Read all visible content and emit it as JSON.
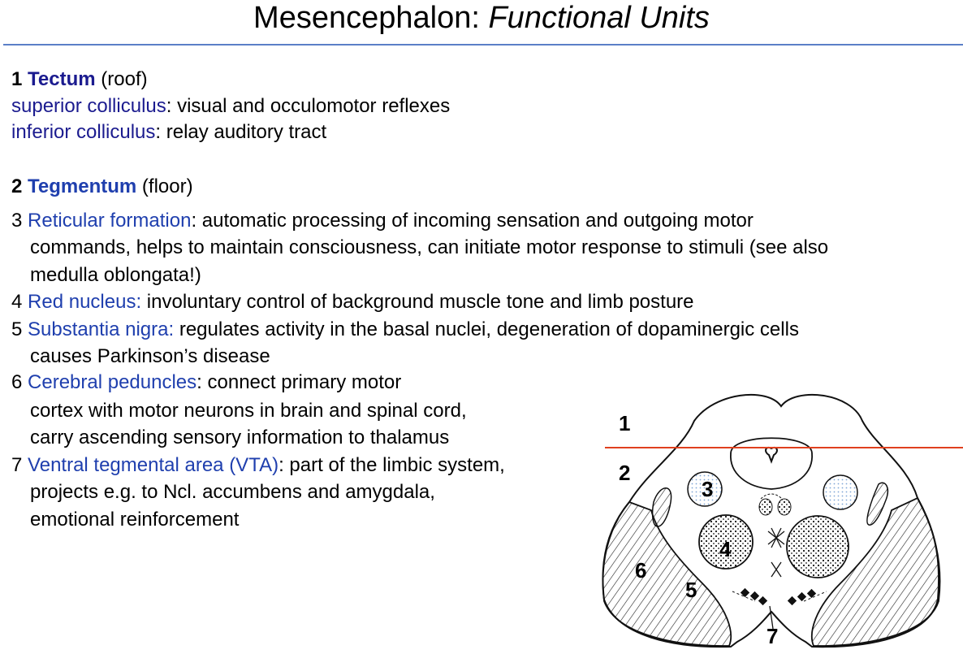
{
  "title": {
    "main": "Mesencephalon: ",
    "italic": "Functional Units"
  },
  "tectum": {
    "num": "1",
    "name": "Tectum",
    "desc": " (roof)",
    "items": [
      {
        "term": "superior colliculus",
        "desc": ": visual and occulomotor reflexes"
      },
      {
        "term": "inferior colliculus",
        "desc": ": relay auditory tract"
      }
    ]
  },
  "tegmentum": {
    "num": "2",
    "name": "Tegmentum",
    "desc": " (floor)"
  },
  "items": [
    {
      "num": "3",
      "term": "Reticular formation",
      "lines": [
        ": automatic processing of incoming sensation and outgoing motor",
        "commands, helps to maintain consciousness, can initiate motor response to stimuli (see also",
        "medulla oblongata!)"
      ]
    },
    {
      "num": "4",
      "term": "Red nucleus:",
      "lines": [
        " involuntary control of background muscle tone and limb posture"
      ]
    },
    {
      "num": "5",
      "term": "Substantia nigra:",
      "lines": [
        " regulates activity in the basal nuclei, degeneration of dopaminergic cells",
        "causes Parkinson’s disease"
      ]
    },
    {
      "num": "6",
      "term": "Cerebral peduncles",
      "lines": [
        ": connect primary motor",
        "cortex with motor neurons in brain and spinal cord,",
        "carry ascending sensory information to thalamus"
      ]
    },
    {
      "num": "7",
      "term": "Ventral tegmental area (VTA)",
      "lines": [
        ": part of the limbic system,",
        "projects e.g. to Ncl. accumbens and amygdala,",
        "emotional reinforcement"
      ]
    }
  ],
  "diagram": {
    "labels": [
      "1",
      "2",
      "3",
      "4",
      "5",
      "6",
      "7"
    ],
    "divider_color": "#e0401e"
  }
}
